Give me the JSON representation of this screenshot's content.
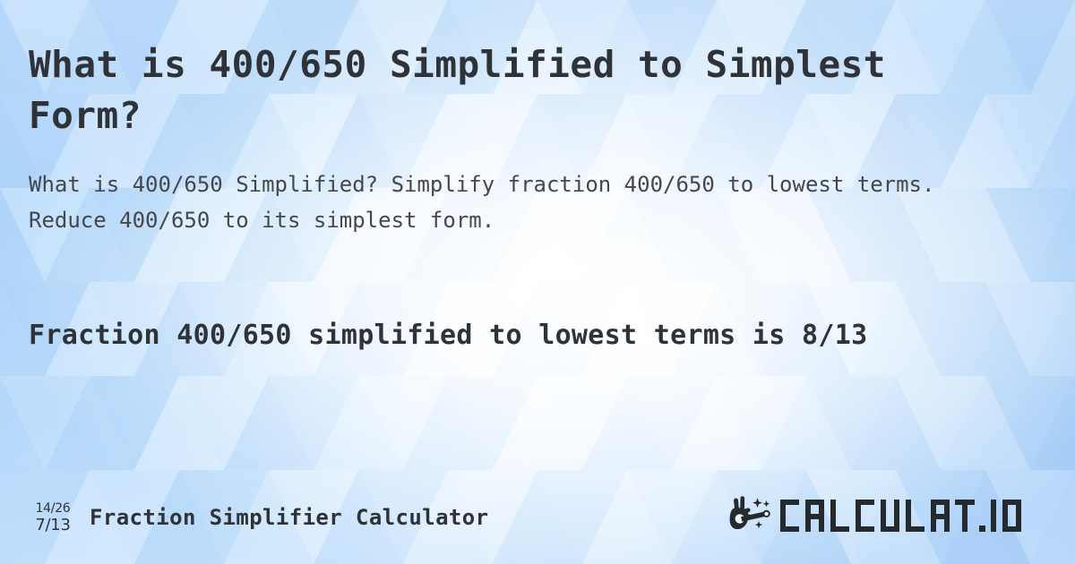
{
  "page": {
    "title": "What is 400/650 Simplified to Simplest Form?",
    "subtitle": "What is 400/650 Simplified? Simplify fraction 400/650 to lowest terms. Reduce 400/650 to its simplest form.",
    "result": "Fraction 400/650 simplified to lowest terms is 8/13"
  },
  "fraction": {
    "numerator": "400",
    "denominator": "650",
    "original": "400/650",
    "simplified": "8/13",
    "simplified_numerator": "8",
    "simplified_denominator": "13"
  },
  "footer": {
    "icon": {
      "name": "fraction-reduce-icon",
      "top": "14/26",
      "bottom": "7/13"
    },
    "site_title": "Fraction Simplifier Calculator",
    "brand": {
      "name": "magic-wand-hand-icon",
      "text": "CALCULAT.IO"
    }
  },
  "colors": {
    "text_primary": "#2f3337",
    "text_secondary": "#44484d",
    "background_blue": "#b9daf9",
    "background_light": "#ffffff",
    "background_deep": "#a4ccf7"
  }
}
